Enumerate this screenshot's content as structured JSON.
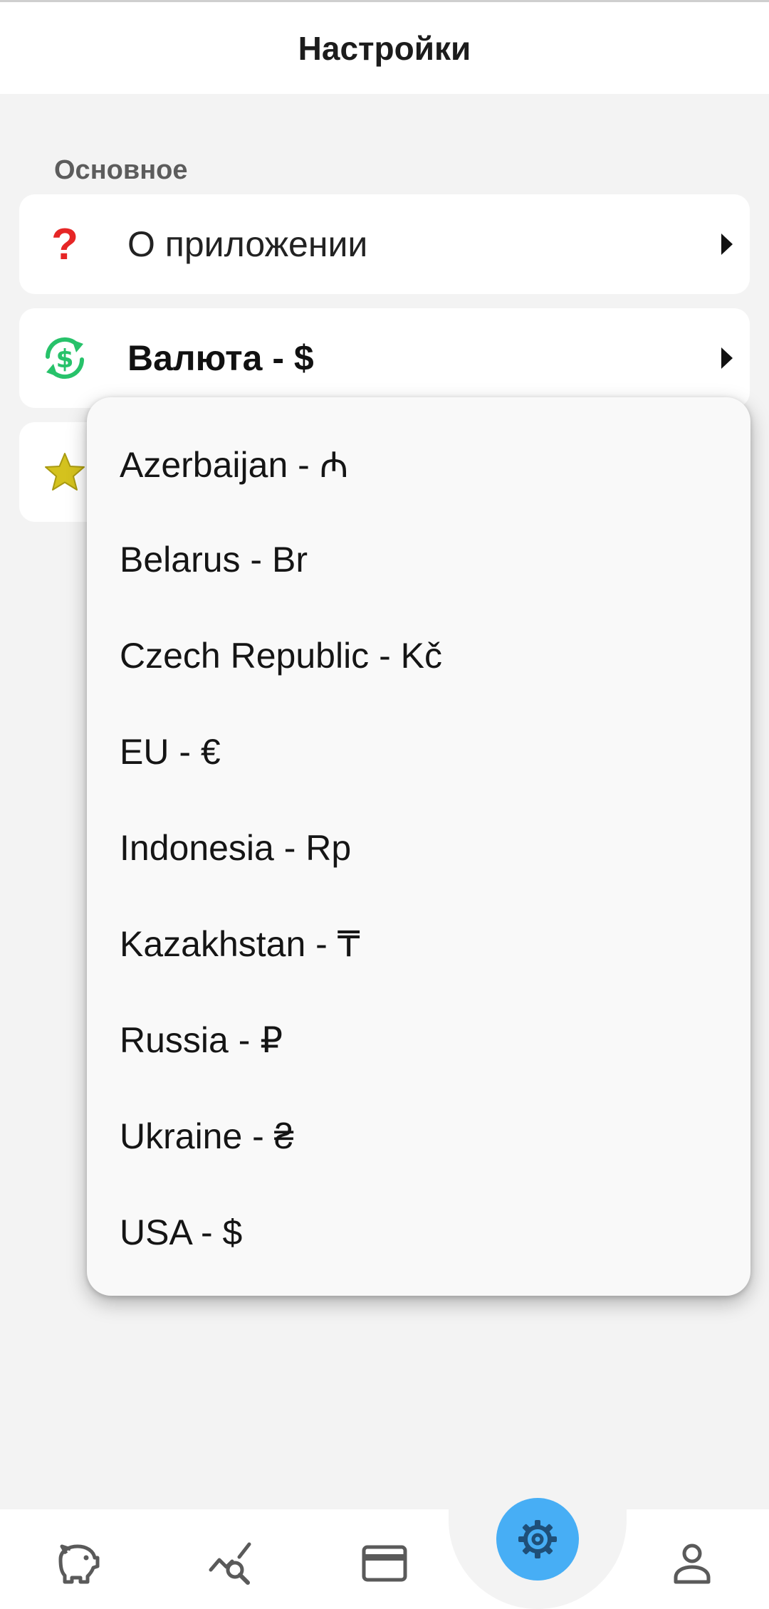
{
  "header": {
    "title": "Настройки"
  },
  "section": {
    "label": "Основное"
  },
  "rows": {
    "about": {
      "label": "О приложении",
      "icon": "question-icon",
      "icon_glyph": "?"
    },
    "currency": {
      "label": "Валюта -  $",
      "icon": "currency-exchange-icon"
    },
    "rate": {
      "icon": "star-icon"
    }
  },
  "dropdown": {
    "items": [
      "Azerbaijan -  ₼",
      "Belarus -  Br",
      "Czech Republic - Kč",
      "EU -  €",
      "Indonesia - Rp",
      "Kazakhstan -  ₸",
      "Russia -  ₽",
      "Ukraine -  ₴",
      "USA - $"
    ]
  },
  "nav": {
    "items": [
      {
        "name": "piggy-bank-icon"
      },
      {
        "name": "analytics-icon"
      },
      {
        "name": "credit-card-icon"
      },
      {
        "name": "settings-icon",
        "active": true
      },
      {
        "name": "profile-icon"
      }
    ]
  },
  "colors": {
    "accent": "#47aef5",
    "question": "#e62626",
    "currency_icon": "#27c26a",
    "star": "#d4c21e"
  }
}
